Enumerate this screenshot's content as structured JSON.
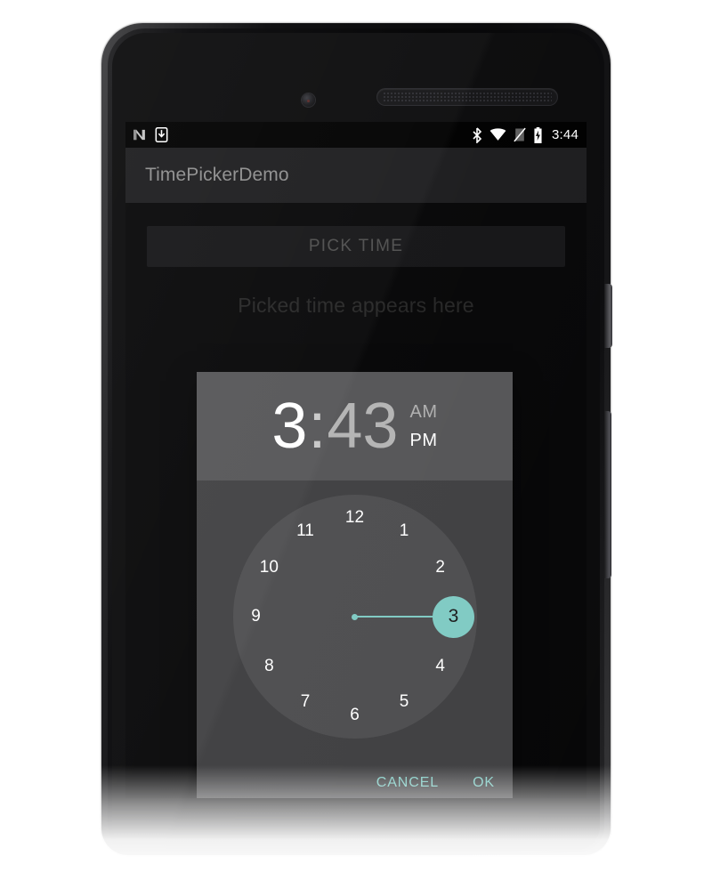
{
  "device": {
    "name": "android-phone",
    "camera_icon": "front-camera-icon",
    "earpiece_icon": "earpiece-speaker-icon",
    "power_button": "power-button",
    "volume_button": "volume-rocker-button"
  },
  "status_bar": {
    "left_icons": [
      {
        "name": "android-n-logo-icon",
        "glyph": "N"
      },
      {
        "name": "download-install-icon",
        "glyph": "↓"
      }
    ],
    "right_icons": [
      {
        "name": "bluetooth-icon"
      },
      {
        "name": "wifi-icon"
      },
      {
        "name": "no-sim-cellular-icon"
      },
      {
        "name": "battery-charging-icon"
      }
    ],
    "time": "3:44"
  },
  "toolbar": {
    "title": "TimePickerDemo"
  },
  "main": {
    "pick_time_label": "PICK TIME",
    "result_text": "Picked time appears here"
  },
  "dialog": {
    "name": "time-picker-dialog",
    "header": {
      "hour": "3",
      "colon": ":",
      "minute": "43",
      "am_label": "AM",
      "pm_label": "PM",
      "selected_meridiem": "PM",
      "selected_field": "hour"
    },
    "clock": {
      "mode": "hours",
      "selected_value": "3",
      "hours": [
        "1",
        "2",
        "3",
        "4",
        "5",
        "6",
        "7",
        "8",
        "9",
        "10",
        "11",
        "12"
      ],
      "hand_angle_degrees": 0
    },
    "actions": {
      "cancel_label": "CANCEL",
      "ok_label": "OK"
    }
  },
  "colors": {
    "accent_teal": "#80cbc4",
    "dialog_body": "#414143",
    "dialog_header": "#565658",
    "clock_face": "#4f4f51",
    "toolbar_bg": "#1d1d1f",
    "screen_bg": "#0c0c0d",
    "status_bar_bg": "#000000",
    "button_bg": "#232325"
  }
}
